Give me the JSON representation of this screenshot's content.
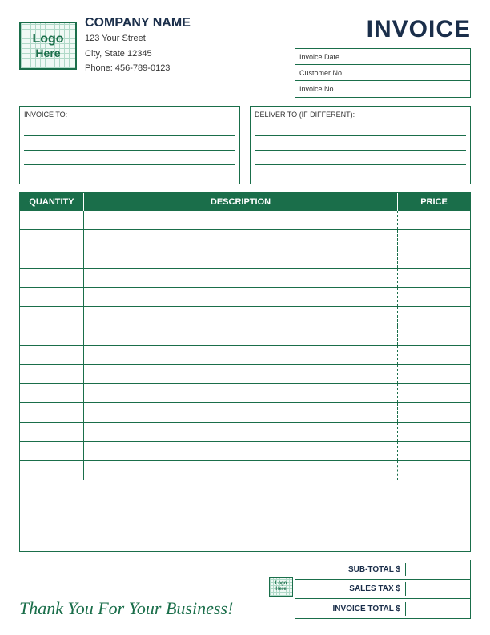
{
  "header": {
    "logo": {
      "line1": "Logo",
      "line2": "Here"
    },
    "company": {
      "name": "COMPANY NAME",
      "street": "123 Your Street",
      "citystate": "City, State 12345",
      "phone": "Phone: 456-789-0123"
    },
    "invoice_title": "INVOICE",
    "fields": [
      {
        "label": "Invoice Date",
        "value": ""
      },
      {
        "label": "Customer No.",
        "value": ""
      },
      {
        "label": "Invoice No.",
        "value": ""
      }
    ]
  },
  "address": {
    "invoice_to_label": "INVOICE TO:",
    "deliver_to_label": "DELIVER TO (If Different):"
  },
  "table": {
    "headers": {
      "quantity": "QUANTITY",
      "description": "DESCRIPTION",
      "price": "PRICE"
    },
    "rows": 14
  },
  "totals": {
    "sub_total_label": "SUB-TOTAL $",
    "sales_tax_label": "SALES TAX $",
    "invoice_total_label": "INVOICE TOTAL $"
  },
  "footer": {
    "thank_you": "Thank You For Your Business!"
  }
}
